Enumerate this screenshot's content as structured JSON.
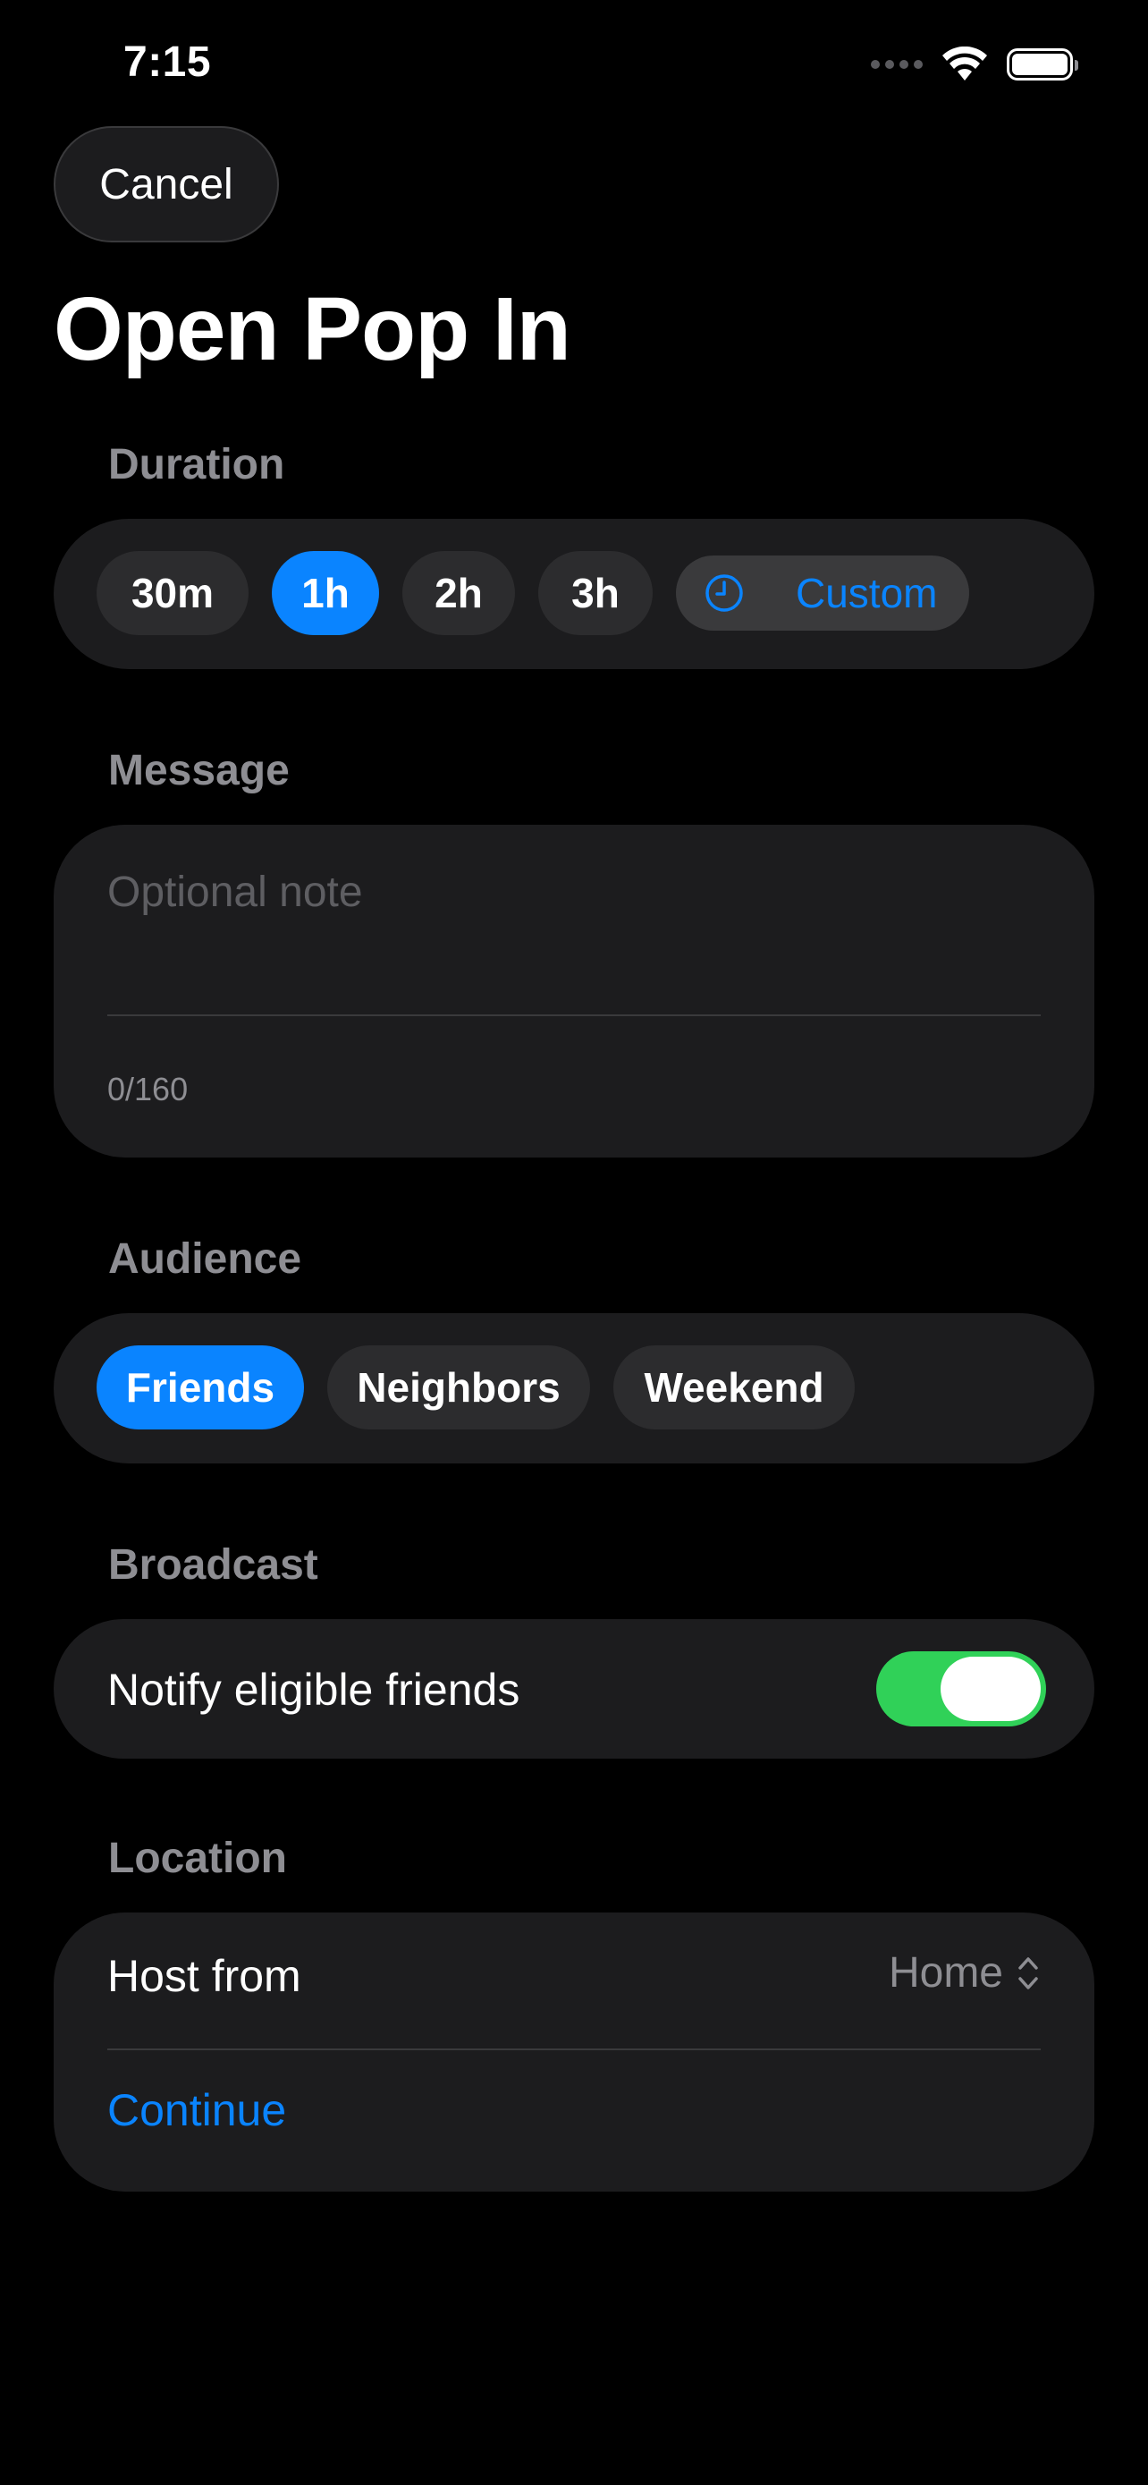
{
  "status_bar": {
    "time": "7:15",
    "icons": [
      "cellular-signal-icon",
      "wifi-icon",
      "battery-icon"
    ],
    "battery_level": 1.0
  },
  "nav": {
    "cancel_label": "Cancel"
  },
  "title": "Open Pop In",
  "duration": {
    "label": "Duration",
    "options": [
      "30m",
      "1h",
      "2h",
      "3h"
    ],
    "selected": "1h",
    "custom_label": "Custom",
    "custom_icon": "clock-icon"
  },
  "message": {
    "label": "Message",
    "placeholder": "Optional note",
    "value": "",
    "counter": "0/160"
  },
  "audience": {
    "label": "Audience",
    "options": [
      "Friends",
      "Neighbors",
      "Weekend"
    ],
    "selected": "Friends"
  },
  "broadcast": {
    "label": "Broadcast",
    "toggle_label": "Notify eligible friends",
    "toggle_on": true
  },
  "location": {
    "label": "Location",
    "host_label": "Host from",
    "host_value": "Home",
    "host_icon": "chevron-up-down-icon",
    "continue_label": "Continue"
  },
  "colors": {
    "background": "#000000",
    "card": "#1c1c1e",
    "accent": "#0a84ff",
    "toggle_on": "#30d158",
    "section_label": "#8e8e93"
  }
}
